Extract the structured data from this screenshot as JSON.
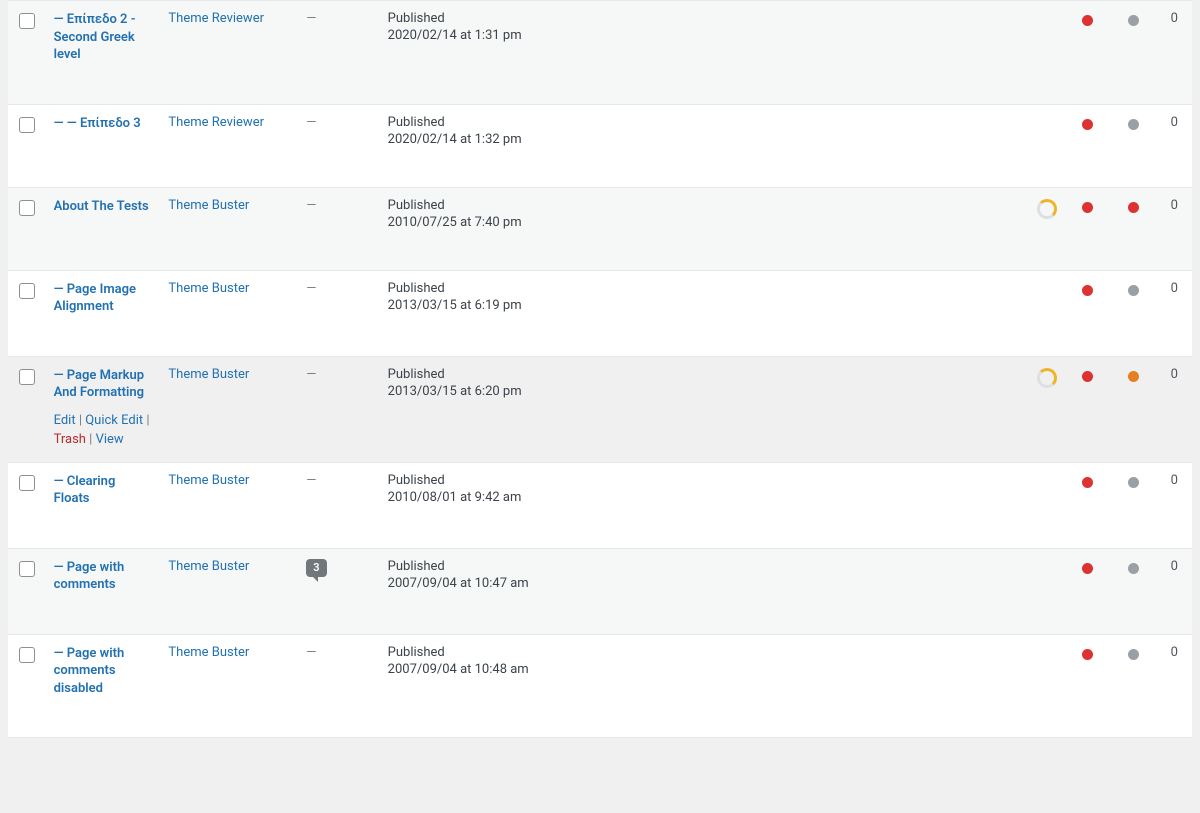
{
  "dash": "—",
  "actions": {
    "edit": "Edit",
    "quick_edit": "Quick Edit",
    "trash": "Trash",
    "view": "View",
    "sep": " | "
  },
  "rows": [
    {
      "title": "— Επίπεδο 2 - Second Greek level",
      "author": "Theme Reviewer",
      "tags": "—",
      "status": "Published",
      "datetime": "2020/02/14 at 1:31 pm",
      "comments": null,
      "spinner": false,
      "seo": "red",
      "read": "grey",
      "links": "0",
      "alt": true,
      "hovered": false
    },
    {
      "title": "— — Επίπεδο 3",
      "author": "Theme Reviewer",
      "tags": "—",
      "status": "Published",
      "datetime": "2020/02/14 at 1:32 pm",
      "comments": null,
      "spinner": false,
      "seo": "red",
      "read": "grey",
      "links": "0",
      "alt": false,
      "hovered": false
    },
    {
      "title": "About The Tests",
      "author": "Theme Buster",
      "tags": "—",
      "status": "Published",
      "datetime": "2010/07/25 at 7:40 pm",
      "comments": null,
      "spinner": true,
      "seo": "red",
      "read": "red",
      "links": "0",
      "alt": true,
      "hovered": false
    },
    {
      "title": "— Page Image Alignment",
      "author": "Theme Buster",
      "tags": "—",
      "status": "Published",
      "datetime": "2013/03/15 at 6:19 pm",
      "comments": null,
      "spinner": false,
      "seo": "red",
      "read": "grey",
      "links": "0",
      "alt": false,
      "hovered": false
    },
    {
      "title": "— Page Markup And Formatting",
      "author": "Theme Buster",
      "tags": "—",
      "status": "Published",
      "datetime": "2013/03/15 at 6:20 pm",
      "comments": null,
      "spinner": true,
      "seo": "red",
      "read": "orange",
      "links": "0",
      "alt": true,
      "hovered": true
    },
    {
      "title": "— Clearing Floats",
      "author": "Theme Buster",
      "tags": "—",
      "status": "Published",
      "datetime": "2010/08/01 at 9:42 am",
      "comments": null,
      "spinner": false,
      "seo": "red",
      "read": "grey",
      "links": "0",
      "alt": false,
      "hovered": false
    },
    {
      "title": "— Page with comments",
      "author": "Theme Buster",
      "tags": null,
      "status": "Published",
      "datetime": "2007/09/04 at 10:47 am",
      "comments": "3",
      "spinner": false,
      "seo": "red",
      "read": "grey",
      "links": "0",
      "alt": true,
      "hovered": false
    },
    {
      "title": "— Page with comments disabled",
      "author": "Theme Buster",
      "tags": "—",
      "status": "Published",
      "datetime": "2007/09/04 at 10:48 am",
      "comments": null,
      "spinner": false,
      "seo": "red",
      "read": "grey",
      "links": "0",
      "alt": false,
      "hovered": false
    }
  ]
}
